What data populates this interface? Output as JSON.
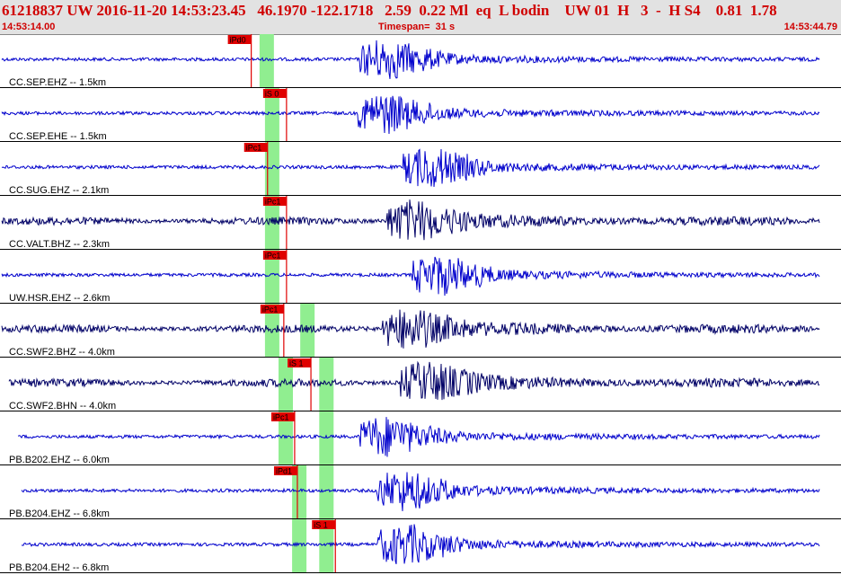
{
  "header": {
    "title": "61218837 UW 2016-11-20 14:53:23.45   46.1970 -122.1718   2.59  0.22 Ml  eq  L bodin    UW 01  H   3  -  H S4    0.81  1.78",
    "start_time": "14:53:14.00",
    "timespan": "Timespan=  31 s",
    "end_time": "14:53:44.79"
  },
  "colors": {
    "pick": "#e00000",
    "window": "#90ee90",
    "trace_blue": "#0000cc",
    "trace_navy": "#000066"
  },
  "panels": [
    {
      "station": "CC.SEP.EHZ -- 1.5km",
      "color": "#0000cc",
      "picks": [
        {
          "label": "iPd0",
          "t": 8.1
        }
      ],
      "windows": [
        9.3
      ],
      "flags": []
    },
    {
      "station": "CC.SEP.EHE -- 1.5km",
      "color": "#0000cc",
      "picks": [
        {
          "label": "iS 0",
          "t": 9.4
        }
      ],
      "windows": [
        9.5
      ],
      "flags": []
    },
    {
      "station": "CC.SUG.EHZ -- 2.1km",
      "color": "#0000cc",
      "picks": [
        {
          "label": "iPc1",
          "t": 8.7
        }
      ],
      "windows": [
        9.5
      ],
      "flags": []
    },
    {
      "station": "CC.VALT.BHZ -- 2.3km",
      "color": "#000066",
      "picks": [
        {
          "label": "iPc1",
          "t": 9.4
        }
      ],
      "windows": [
        9.5
      ],
      "flags": []
    },
    {
      "station": "UW.HSR.EHZ -- 2.6km",
      "color": "#0000cc",
      "picks": [
        {
          "label": "iPc1",
          "t": 9.4
        }
      ],
      "windows": [
        9.5
      ],
      "flags": []
    },
    {
      "station": "CC.SWF2.BHZ -- 4.0km",
      "color": "#000066",
      "picks": [
        {
          "label": "iPc1",
          "t": 9.3
        }
      ],
      "windows": [
        9.5,
        10.8
      ],
      "flags": []
    },
    {
      "station": "CC.SWF2.BHN -- 4.0km",
      "color": "#000066",
      "picks": [
        {
          "label": "iS 1",
          "t": 10.3
        }
      ],
      "windows": [
        10.0,
        11.5
      ],
      "flags": []
    },
    {
      "station": "PB.B202.EHZ -- 6.0km",
      "color": "#0000cc",
      "picks": [
        {
          "label": "iPc1",
          "t": 9.7
        }
      ],
      "windows": [
        10.0,
        11.5
      ],
      "flags": []
    },
    {
      "station": "PB.B204.EHZ -- 6.8km",
      "color": "#0000cc",
      "picks": [
        {
          "label": "iPd1",
          "t": 9.8
        }
      ],
      "windows": [
        10.5,
        11.5
      ],
      "flags": []
    },
    {
      "station": "PB.B204.EH2 -- 6.8km",
      "color": "#0000cc",
      "picks": [
        {
          "label": "iS 1",
          "t": 11.2
        }
      ],
      "windows": [
        10.5,
        11.5
      ],
      "flags": []
    }
  ]
}
